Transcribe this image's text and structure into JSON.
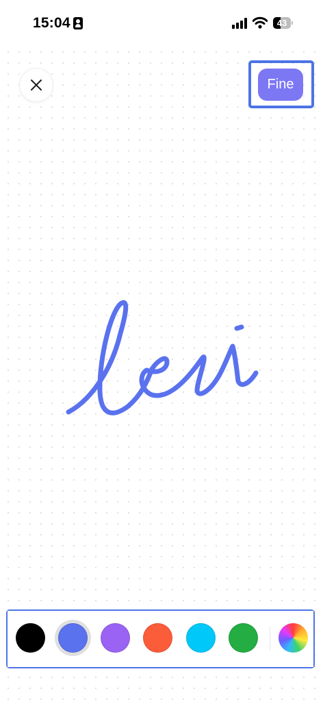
{
  "status_bar": {
    "time": "15:04",
    "battery_level": "43",
    "battery_fraction": 0.43,
    "icons": [
      "contact-card-icon",
      "cellular-signal-icon",
      "wifi-icon",
      "battery-icon"
    ]
  },
  "toolbar": {
    "close_icon": "close-icon",
    "done_label": "Fine"
  },
  "drawing": {
    "handwritten_text": "leii",
    "stroke_color": "#5a72ee"
  },
  "palette": {
    "colors": [
      {
        "name": "black",
        "hex": "#000000"
      },
      {
        "name": "blue",
        "hex": "#5a72ee",
        "selected": true
      },
      {
        "name": "purple",
        "hex": "#9a63f3"
      },
      {
        "name": "red-orange",
        "hex": "#fb5c3a"
      },
      {
        "name": "cyan",
        "hex": "#00c8f9"
      },
      {
        "name": "green",
        "hex": "#23ad43"
      }
    ],
    "custom_color_icon": "color-wheel-icon"
  },
  "highlight_color": "#4c74e6",
  "accent_color": "#7c78f4"
}
